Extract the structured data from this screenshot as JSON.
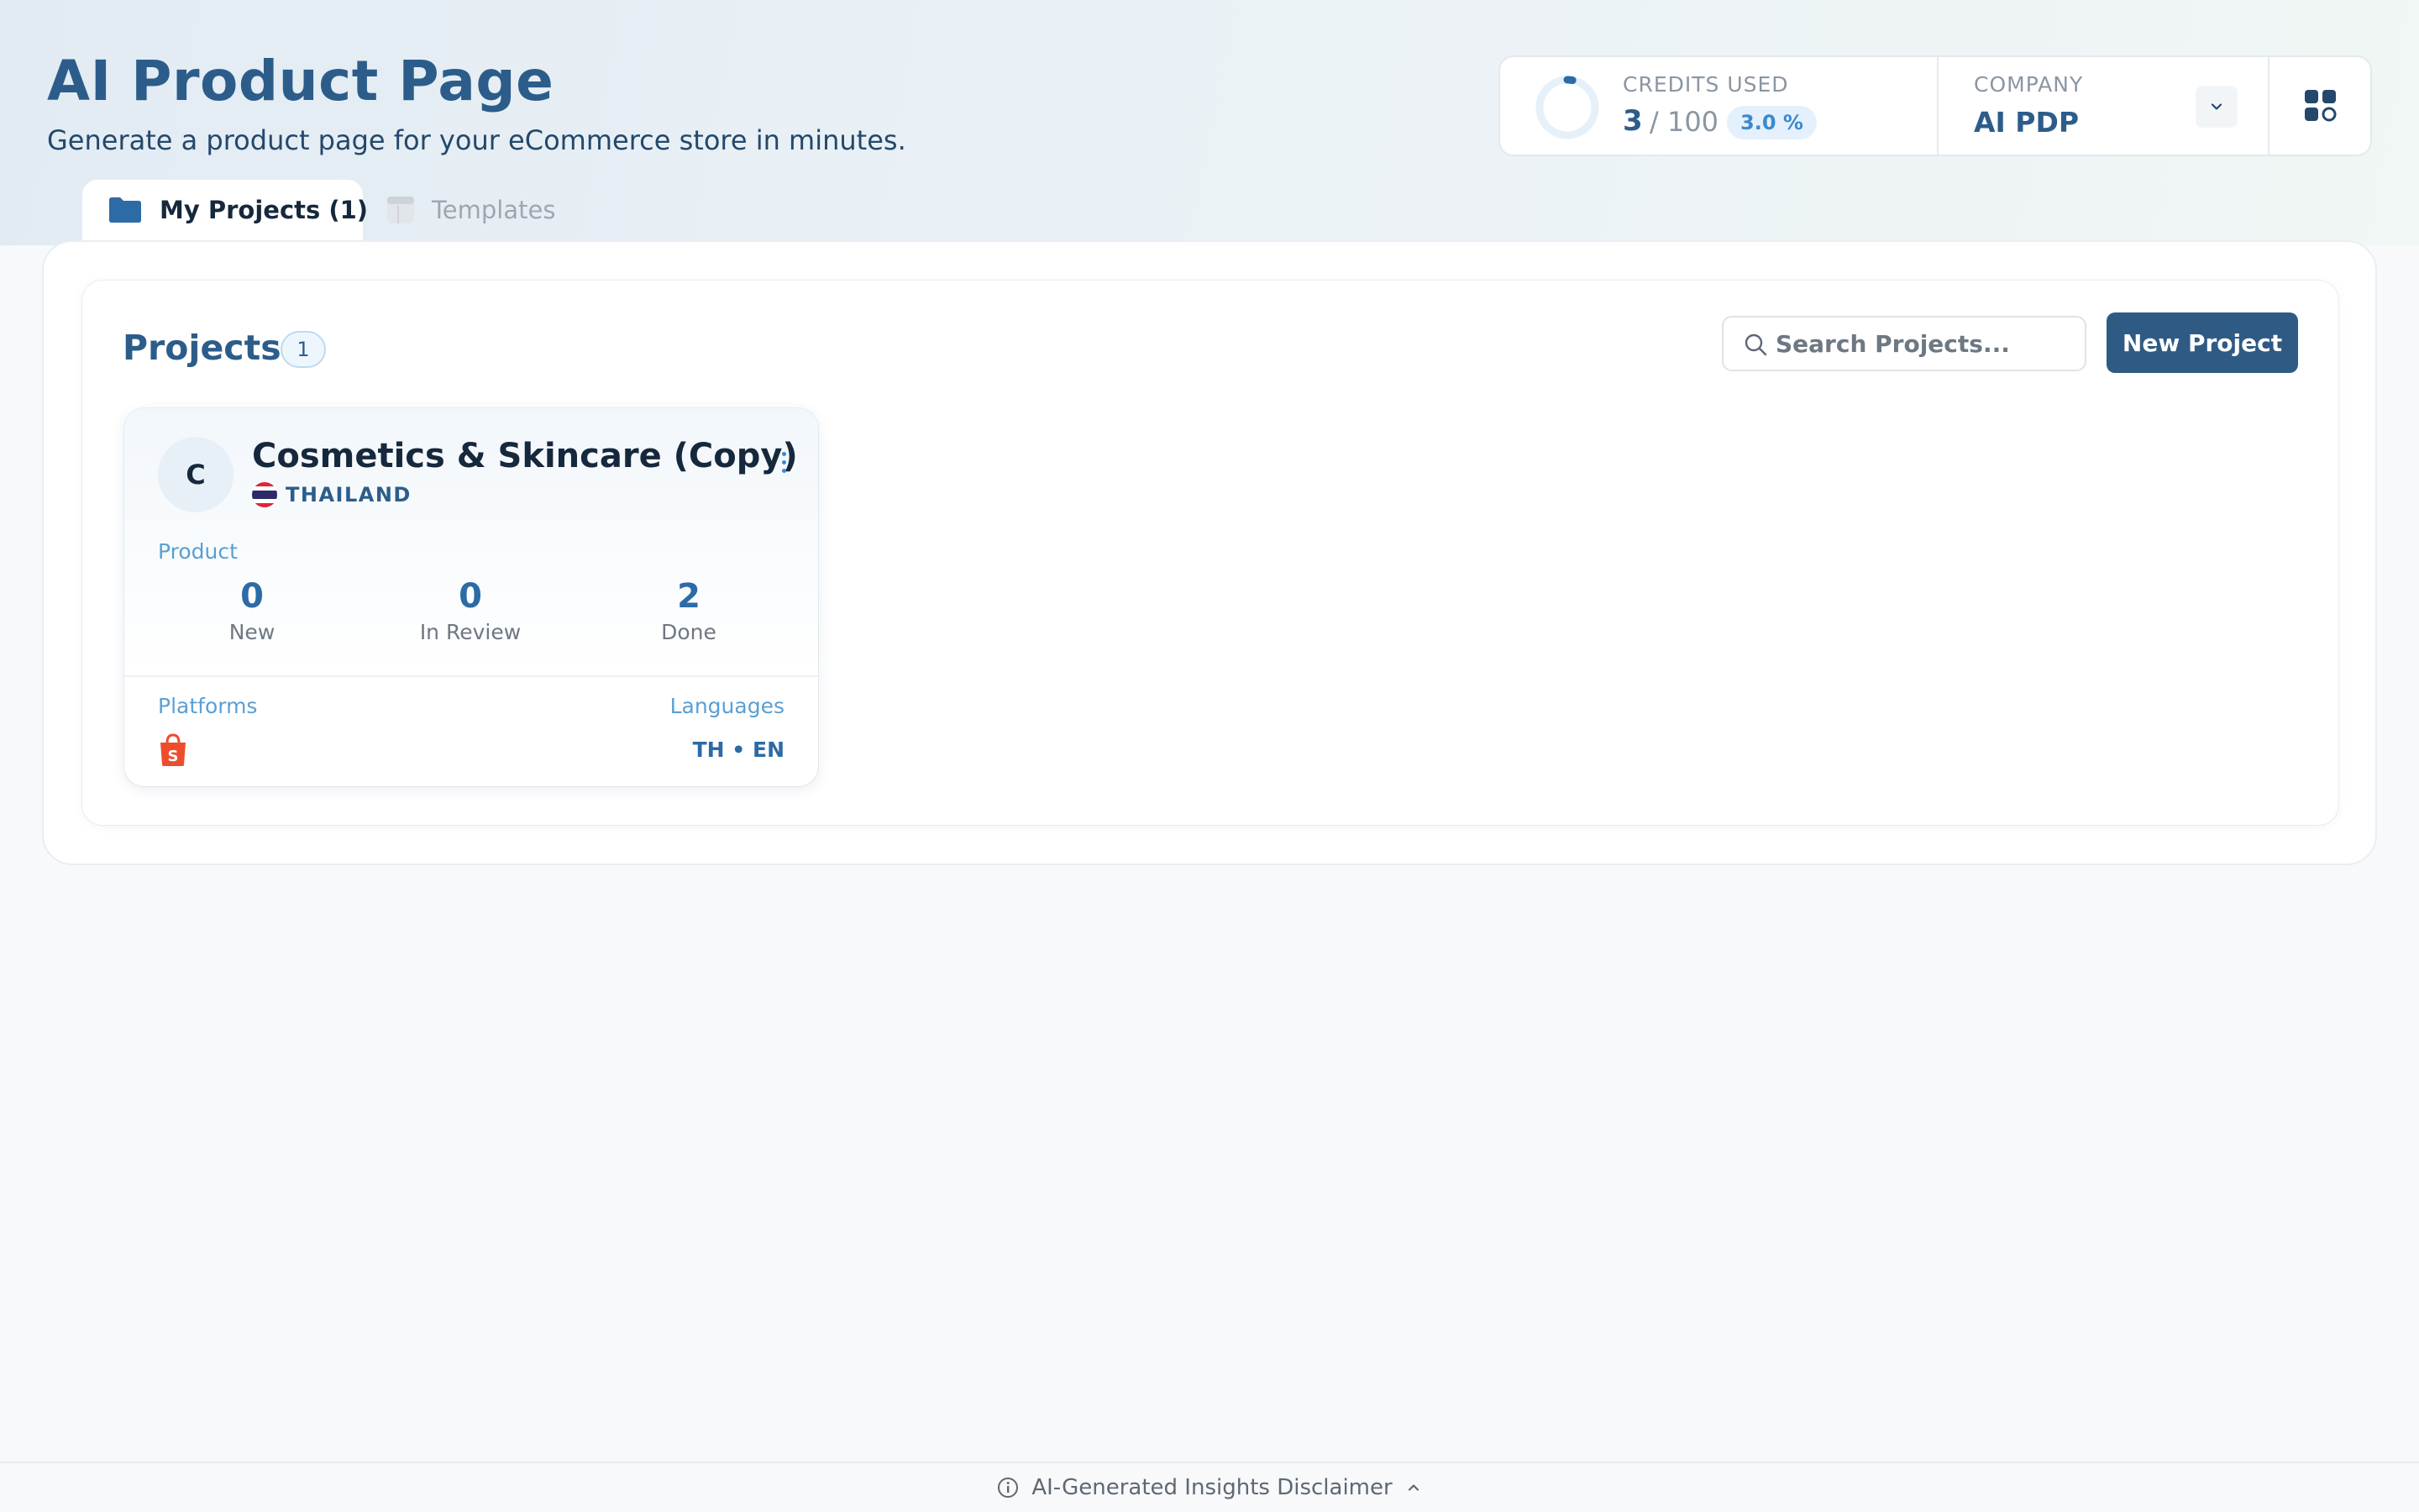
{
  "header": {
    "title": "AI Product Page",
    "subtitle": "Generate a product page for your eCommerce store in minutes."
  },
  "credits": {
    "label": "CREDITS USED",
    "used": "3",
    "total": "/ 100",
    "percent_text": "3.0 %",
    "fraction": 0.03
  },
  "company": {
    "label": "COMPANY",
    "name": "AI PDP"
  },
  "tabs": [
    {
      "label": "My Projects (1)",
      "icon": "folder-icon",
      "active": true
    },
    {
      "label": "Templates",
      "icon": "template-icon",
      "active": false
    }
  ],
  "projects": {
    "title": "Projects",
    "count": "1",
    "search_placeholder": "Search Projects...",
    "new_button_label": "New Project",
    "items": [
      {
        "avatar_letter": "C",
        "name": "Cosmetics & Skincare (Copy)",
        "country": "THAILAND",
        "product_label": "Product",
        "stats": [
          {
            "value": "0",
            "label": "New"
          },
          {
            "value": "0",
            "label": "In Review"
          },
          {
            "value": "2",
            "label": "Done"
          }
        ],
        "platforms_label": "Platforms",
        "platform_icon": "shopee-bag-icon",
        "languages_label": "Languages",
        "languages": "TH • EN"
      }
    ]
  },
  "footer": {
    "disclaimer": "AI-Generated Insights Disclaimer"
  },
  "colors": {
    "brand": "#2c5d8a",
    "button": "#2f5a84",
    "accent": "#3b89d0",
    "shopee": "#ee4d2d"
  }
}
